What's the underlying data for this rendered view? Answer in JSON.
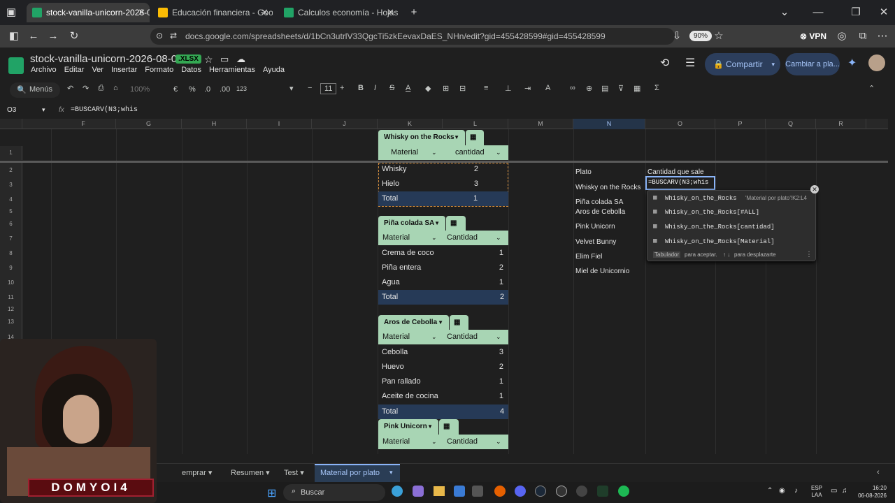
{
  "browser": {
    "tabs": [
      {
        "title": "stock-vanilla-unicorn-2026-08-0",
        "color": "#21a366"
      },
      {
        "title": "Educación financiera - Google D",
        "color": "#fbbc04"
      },
      {
        "title": "Calculos economía - Hojas de cá",
        "color": "#21a366"
      }
    ],
    "url": "docs.google.com/spreadsheets/d/1bCn3utrlV33QgcTi5zkEevaxDaES_NHn/edit?gid=455428599#gid=455428599",
    "zoom": "90%",
    "vpn": "VPN"
  },
  "app": {
    "doc_name": "stock-vanilla-unicorn-2026-08-05",
    "badge": ".XLSX",
    "menus": [
      "Archivo",
      "Editar",
      "Ver",
      "Insertar",
      "Formato",
      "Datos",
      "Herramientas",
      "Ayuda"
    ],
    "share": "Compartir",
    "switch": "Cambiar a pla..."
  },
  "toolbar": {
    "menus": "Menús",
    "zoom": "100%",
    "currency": "€",
    "percent": "%",
    "dec_dec": ".0",
    "dec_inc": ".00",
    "numfmt": "123",
    "font_size": "11"
  },
  "formula_bar": {
    "cell": "O3",
    "fx": "fx",
    "formula": "=BUSCARV(N3;whis"
  },
  "columns": [
    "F",
    "G",
    "H",
    "I",
    "J",
    "K",
    "L",
    "M",
    "N",
    "O",
    "P",
    "Q",
    "R"
  ],
  "rows": [
    "1",
    "2",
    "3",
    "4",
    "5",
    "6",
    "7",
    "8",
    "9",
    "10",
    "11",
    "12",
    "13",
    "14",
    "15",
    "16",
    "17",
    "18",
    "19",
    "20"
  ],
  "tables": [
    {
      "name": "Whisky on the Rocks",
      "headers": [
        "Material",
        "cantidad"
      ],
      "rows": [
        [
          "Whisky",
          "2"
        ],
        [
          "Hielo",
          "3"
        ]
      ],
      "total": [
        "Total",
        "1"
      ]
    },
    {
      "name": "Piña colada SA",
      "headers": [
        "Material",
        "Cantidad"
      ],
      "rows": [
        [
          "Crema de coco",
          "1"
        ],
        [
          "Piña entera",
          "2"
        ],
        [
          "Agua",
          "1"
        ]
      ],
      "total": [
        "Total",
        "2"
      ]
    },
    {
      "name": "Aros de Cebolla",
      "headers": [
        "Material",
        "Cantidad"
      ],
      "rows": [
        [
          "Cebolla",
          "3"
        ],
        [
          "Huevo",
          "2"
        ],
        [
          "Pan rallado",
          "1"
        ],
        [
          "Aceite de cocina",
          "1"
        ]
      ],
      "total": [
        "Total",
        "4"
      ]
    },
    {
      "name": "Pink Unicorn",
      "headers": [
        "Material",
        "Cantidad"
      ]
    }
  ],
  "lookup": {
    "plato_header": "Plato",
    "cantidad_header": "Cantidad que sale",
    "editing": "=BUSCARV(N3;whis",
    "platos": [
      "Whisky on the Rocks",
      "Piña colada SA",
      "Aros de Cebolla",
      "Pink Unicorn",
      "Velvet Bunny",
      "Elim Fiel",
      "Miel de Unicornio"
    ]
  },
  "autocomplete": {
    "items": [
      "Whisky_on_the_Rocks",
      "Whisky_on_the_Rocks[#ALL]",
      "Whisky_on_the_Rocks[cantidad]",
      "Whisky_on_the_Rocks[Material]"
    ],
    "ref": "'Material por plato'!K2:L4",
    "hint_key": "Tabulador",
    "hint_accept": "para aceptar.",
    "hint_scroll": "para desplazarte"
  },
  "sheets": [
    "emprar",
    "Resumen",
    "Test",
    "Material por plato"
  ],
  "taskbar": {
    "search": "Buscar",
    "lang": "ESP",
    "region": "LAA",
    "time": "16:20",
    "date": "06-08-2026"
  },
  "webcam": {
    "overlay_name": "DOMYOI4"
  }
}
